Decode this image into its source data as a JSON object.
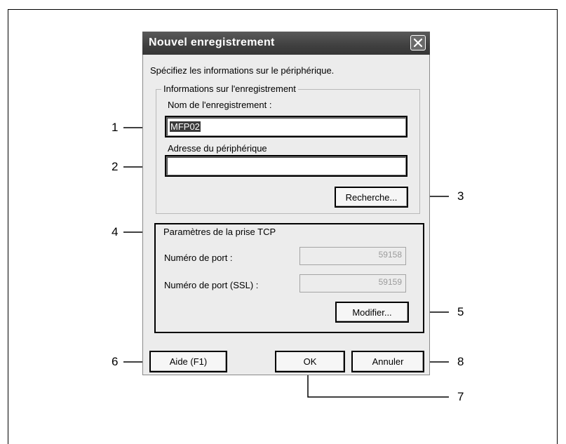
{
  "dialog": {
    "title": "Nouvel enregistrement",
    "prompt": "Spécifiez les informations sur le périphérique.",
    "registration_group": {
      "legend": "Informations sur l'enregistrement",
      "name_label": "Nom de l'enregistrement :",
      "name_value": "MFP02",
      "address_label": "Adresse du périphérique",
      "address_value": "",
      "search_button": "Recherche..."
    },
    "tcp_group": {
      "legend": "Paramètres de la prise TCP",
      "port_label": "Numéro de port :",
      "port_value": "59158",
      "ssl_port_label": "Numéro de port (SSL) :",
      "ssl_port_value": "59159",
      "modify_button": "Modifier..."
    },
    "buttons": {
      "help": "Aide (F1)",
      "ok": "OK",
      "cancel": "Annuler"
    }
  },
  "callouts": [
    "1",
    "2",
    "3",
    "4",
    "5",
    "6",
    "7",
    "8"
  ],
  "icons": {
    "close": "close-icon"
  }
}
